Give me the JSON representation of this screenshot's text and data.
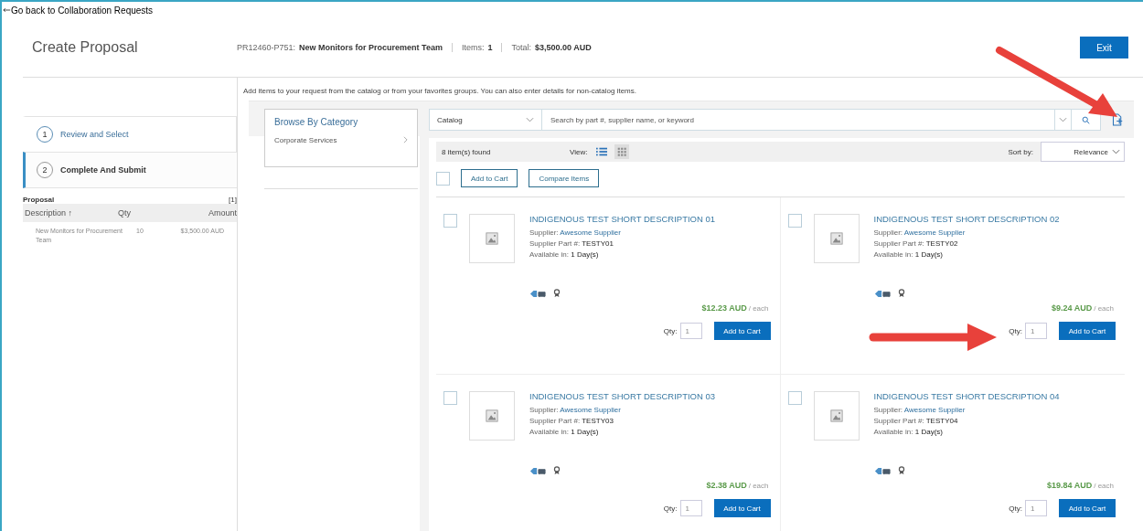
{
  "back_link": {
    "label": "Go back to Collaboration Requests"
  },
  "header": {
    "title": "Create Proposal",
    "request_id": "PR12460-P751:",
    "request_name": "New Monitors for Procurement Team",
    "items_label": "Items:",
    "items_value": "1",
    "total_label": "Total:",
    "total_value": "$3,500.00 AUD",
    "exit_button": "Exit"
  },
  "steps": [
    {
      "number": "1",
      "label": "Review and Select",
      "selected": false
    },
    {
      "number": "2",
      "label": "Complete And Submit",
      "selected": true
    }
  ],
  "proposal": {
    "title": "Proposal",
    "count": "[1]",
    "columns": [
      "Description",
      "Qty",
      "Amount"
    ],
    "sort_mark": "↑",
    "rows": [
      {
        "description": "New Monitors for Procurement Team",
        "qty": "10",
        "amount": "$3,500.00 AUD"
      }
    ]
  },
  "intro": "Add items to your request from the catalog or from your favorites groups. You can also enter details for non-catalog items.",
  "category": {
    "title": "Browse By Category",
    "items": [
      "Corporate Services"
    ]
  },
  "search": {
    "scope": "Catalog",
    "placeholder": "Search by part #, supplier name, or keyword"
  },
  "results": {
    "count": "8 item(s) found",
    "view_label": "View:",
    "view_modes": [
      {
        "kind": "list",
        "selected": false
      },
      {
        "kind": "grid",
        "selected": true
      }
    ],
    "sort_label": "Sort by:",
    "sort_value": "Relevance",
    "add_to_cart": "Add to Cart",
    "compare": "Compare Items",
    "select_all_checked": false
  },
  "products": [
    {
      "title": "INDIGENOUS TEST SHORT DESCRIPTION 01",
      "supplier_label": "Supplier:",
      "supplier": "Awesome Supplier",
      "part_label": "Supplier Part #:",
      "part": "TESTY01",
      "avail_label": "Available in:",
      "avail": "1 Day(s)",
      "price": "$12.23 AUD",
      "unit": "/ each",
      "qty_label": "Qty:",
      "qty": "1",
      "button": "Add to Cart",
      "checked": false
    },
    {
      "title": "INDIGENOUS TEST SHORT DESCRIPTION 02",
      "supplier_label": "Supplier:",
      "supplier": "Awesome Supplier",
      "part_label": "Supplier Part #:",
      "part": "TESTY02",
      "avail_label": "Available in:",
      "avail": "1 Day(s)",
      "price": "$9.24 AUD",
      "unit": "/ each",
      "qty_label": "Qty:",
      "qty": "1",
      "button": "Add to Cart",
      "checked": false
    },
    {
      "title": "INDIGENOUS TEST SHORT DESCRIPTION 03",
      "supplier_label": "Supplier:",
      "supplier": "Awesome Supplier",
      "part_label": "Supplier Part #:",
      "part": "TESTY03",
      "avail_label": "Available in:",
      "avail": "1 Day(s)",
      "price": "$2.38 AUD",
      "unit": "/ each",
      "qty_label": "Qty:",
      "qty": "1",
      "button": "Add to Cart",
      "checked": false
    },
    {
      "title": "INDIGENOUS TEST SHORT DESCRIPTION 04",
      "supplier_label": "Supplier:",
      "supplier": "Awesome Supplier",
      "part_label": "Supplier Part #:",
      "part": "TESTY04",
      "avail_label": "Available in:",
      "avail": "1 Day(s)",
      "price": "$19.84 AUD",
      "unit": "/ each",
      "qty_label": "Qty:",
      "qty": "1",
      "button": "Add to Cart",
      "checked": false
    }
  ]
}
